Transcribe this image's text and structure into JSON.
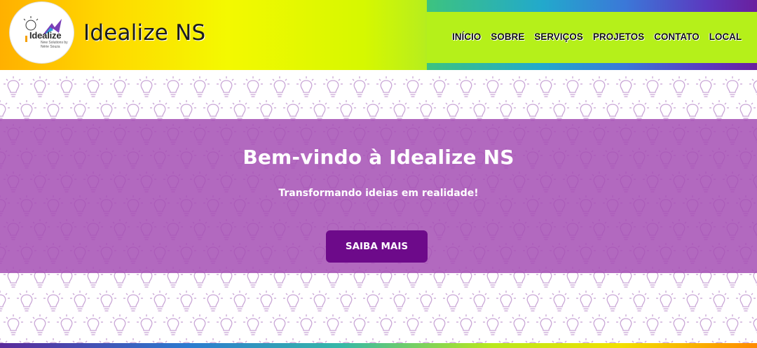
{
  "header": {
    "logo": {
      "word": "Idealize",
      "tagline": "New Solutions by Nérie Souza"
    },
    "brand_title": "Idealize NS",
    "nav": [
      {
        "label": "INÍCIO"
      },
      {
        "label": "SOBRE"
      },
      {
        "label": "SERVIÇOS"
      },
      {
        "label": "PROJETOS"
      },
      {
        "label": "CONTATO"
      },
      {
        "label": "LOCAL"
      }
    ]
  },
  "hero": {
    "title": "Bem-vindo à Idealize NS",
    "subtitle": "Transformando ideias em realidade!",
    "cta_label": "SAIBA MAIS"
  },
  "colors": {
    "hero_overlay": "#a550b4",
    "cta_background": "#6d0a8a",
    "nav_background": "#b5f01a",
    "pattern_stroke": "#c9a6d6"
  },
  "icons": [
    "lightbulb-icon",
    "logo-icon"
  ]
}
